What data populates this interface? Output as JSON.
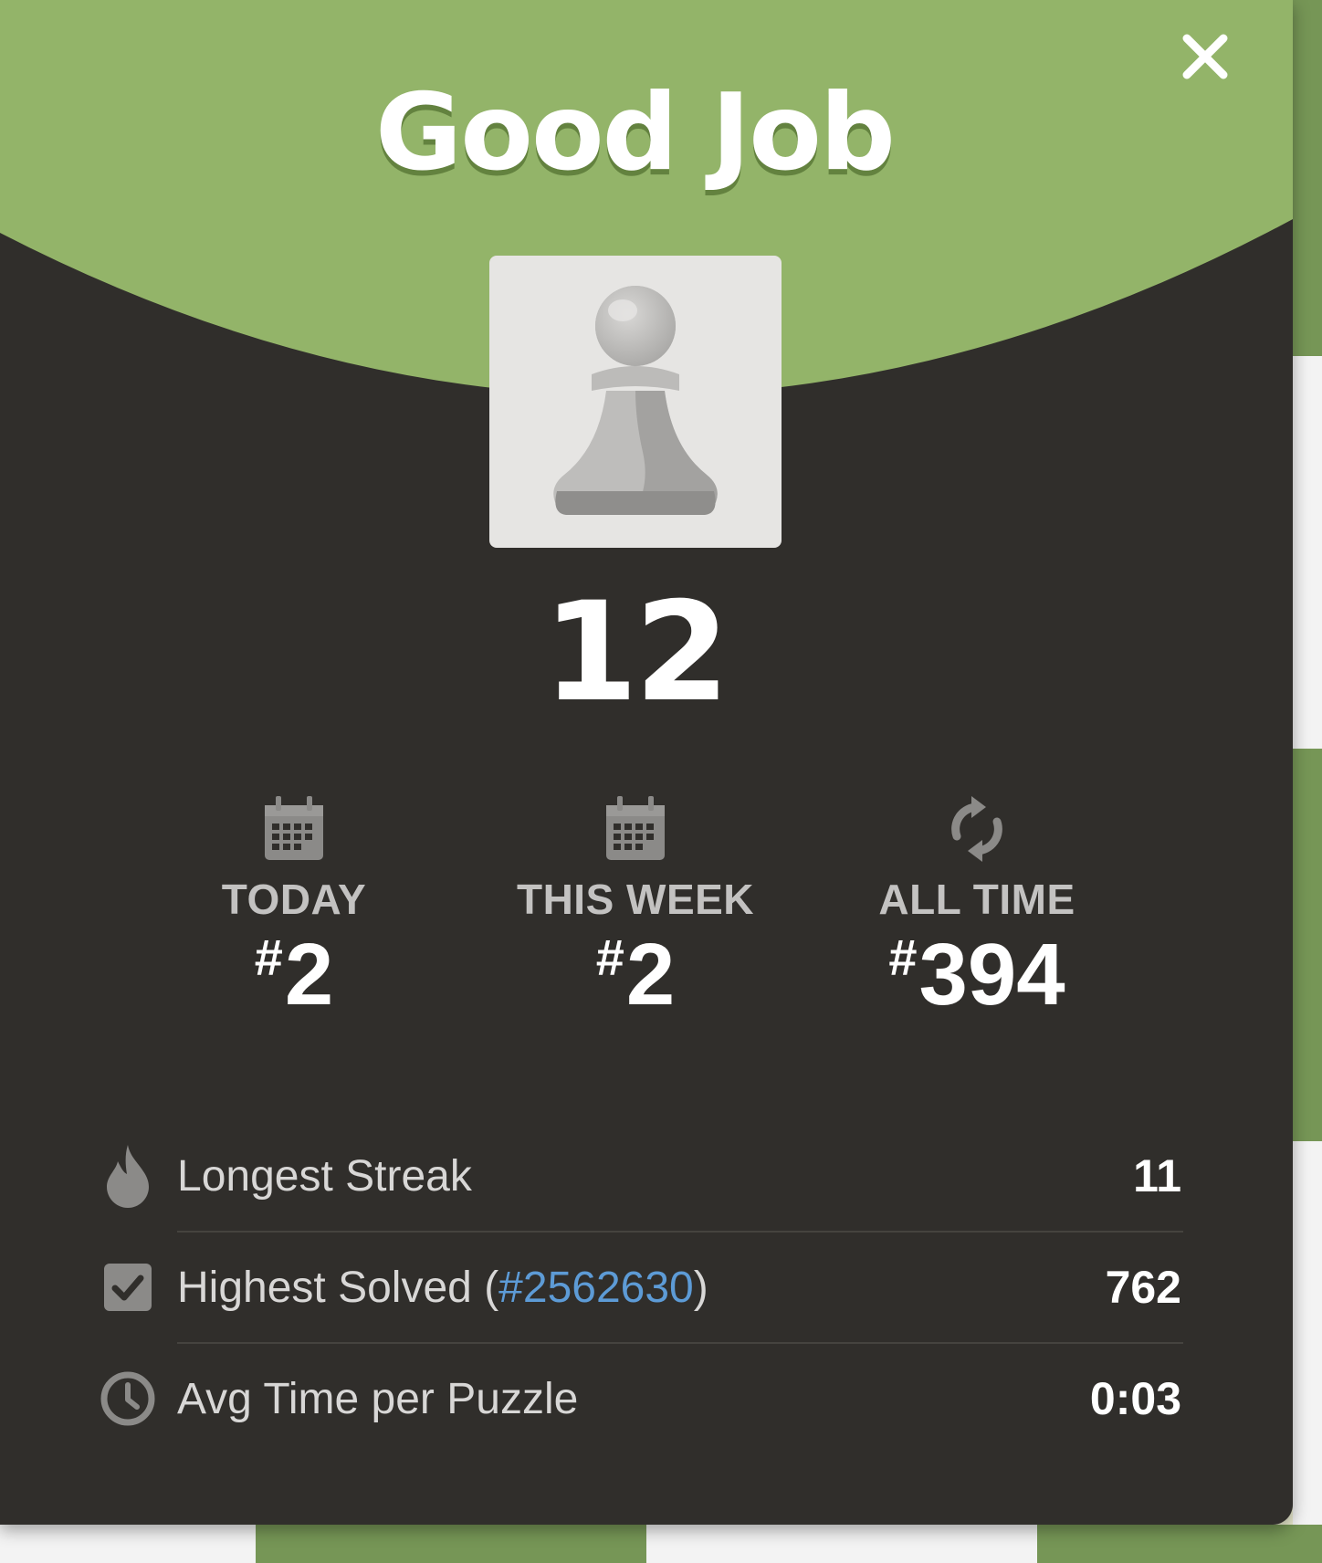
{
  "modal": {
    "title": "Good Job",
    "close_icon": "close-icon",
    "piece_icon": "pawn-icon",
    "score": "12"
  },
  "ranks": [
    {
      "icon": "calendar-icon",
      "label": "TODAY",
      "hash": "#",
      "value": "2"
    },
    {
      "icon": "calendar-icon",
      "label": "THIS WEEK",
      "hash": "#",
      "value": "2"
    },
    {
      "icon": "refresh-icon",
      "label": "ALL TIME",
      "hash": "#",
      "value": "394"
    }
  ],
  "stats": {
    "longest_streak": {
      "icon": "flame-icon",
      "label": "Longest Streak",
      "value": "11"
    },
    "highest_solved": {
      "icon": "checkbox-icon",
      "label_prefix": "Highest Solved (",
      "link": "#2562630",
      "label_suffix": ")",
      "value": "762"
    },
    "avg_time": {
      "icon": "clock-icon",
      "label": "Avg Time per Puzzle",
      "value": "0:03"
    }
  },
  "colors": {
    "header_green": "#93b469",
    "modal_bg": "#302e2b",
    "link_blue": "#5d9bd6",
    "icon_gray": "#8b8a88"
  }
}
